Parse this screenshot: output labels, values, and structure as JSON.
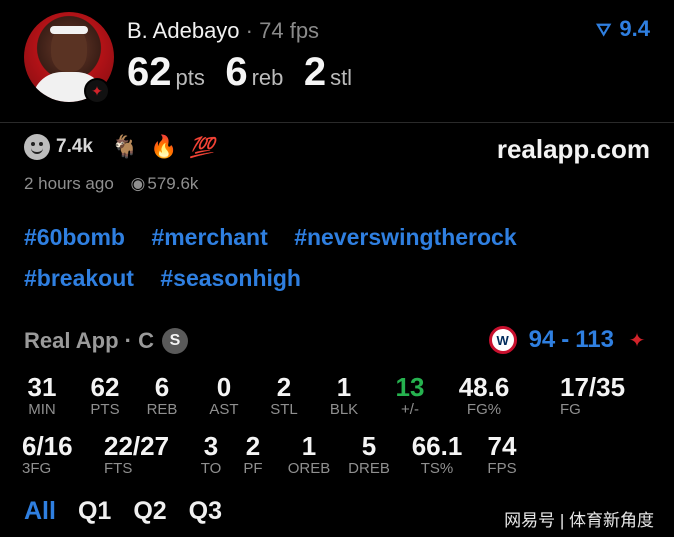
{
  "player": {
    "name": "B. Adebayo",
    "fps": "74 fps",
    "rating": "9.4",
    "headline": [
      {
        "value": "62",
        "unit": "pts"
      },
      {
        "value": "6",
        "unit": "reb"
      },
      {
        "value": "2",
        "unit": "stl"
      }
    ]
  },
  "social": {
    "reaction_count": "7.4k",
    "emojis": [
      "🐐",
      "🔥",
      "💯"
    ],
    "brand": "realapp.com",
    "posted": "2 hours ago",
    "views": "579.6k"
  },
  "tags": [
    "#60bomb",
    "#merchant",
    "#neverswingtherock",
    "#breakout",
    "#seasonhigh"
  ],
  "game": {
    "source": "Real App · C",
    "badge": "S",
    "away_score": "94",
    "home_score": "113"
  },
  "stats_row1": [
    {
      "value": "31",
      "label": "MIN"
    },
    {
      "value": "62",
      "label": "PTS"
    },
    {
      "value": "6",
      "label": "REB"
    },
    {
      "value": "0",
      "label": "AST"
    },
    {
      "value": "2",
      "label": "STL"
    },
    {
      "value": "1",
      "label": "BLK"
    },
    {
      "value": "13",
      "label": "+/-"
    },
    {
      "value": "48.6",
      "label": "FG%"
    },
    {
      "value": "17/35",
      "label": "FG"
    }
  ],
  "stats_row2": [
    {
      "value": "6/16",
      "label": "3FG"
    },
    {
      "value": "22/27",
      "label": "FTS"
    },
    {
      "value": "3",
      "label": "TO"
    },
    {
      "value": "2",
      "label": "PF"
    },
    {
      "value": "1",
      "label": "OREB"
    },
    {
      "value": "5",
      "label": "DREB"
    },
    {
      "value": "66.1",
      "label": "TS%"
    },
    {
      "value": "74",
      "label": "FPS"
    }
  ],
  "periods": [
    "All",
    "Q1",
    "Q2",
    "Q3"
  ],
  "watermark": "网易号 | 体育新角度",
  "colors": {
    "accent": "#2f7fe0",
    "positive": "#26b24f",
    "heat": "#d2232a"
  }
}
